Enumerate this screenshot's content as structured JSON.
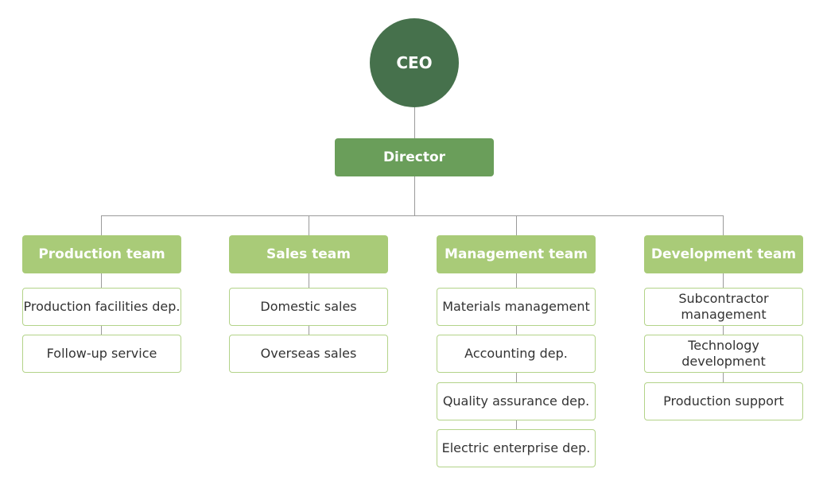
{
  "chart": {
    "ceo": "CEO",
    "director": "Director",
    "teams": [
      {
        "name": "Production team",
        "departments": [
          "Production facilities dep.",
          "Follow-up service"
        ]
      },
      {
        "name": "Sales team",
        "departments": [
          "Domestic sales",
          "Overseas sales"
        ]
      },
      {
        "name": "Management team",
        "departments": [
          "Materials management",
          "Accounting dep.",
          "Quality assurance dep.",
          "Electric enterprise dep."
        ]
      },
      {
        "name": "Development team",
        "departments": [
          "Subcontractor management",
          "Technology development",
          "Production support"
        ]
      }
    ]
  },
  "colors": {
    "ceo": "#46714c",
    "director": "#6a9e5a",
    "team": "#a9cb78",
    "department_border": "#b3d389",
    "connector": "#9a9a9a"
  }
}
